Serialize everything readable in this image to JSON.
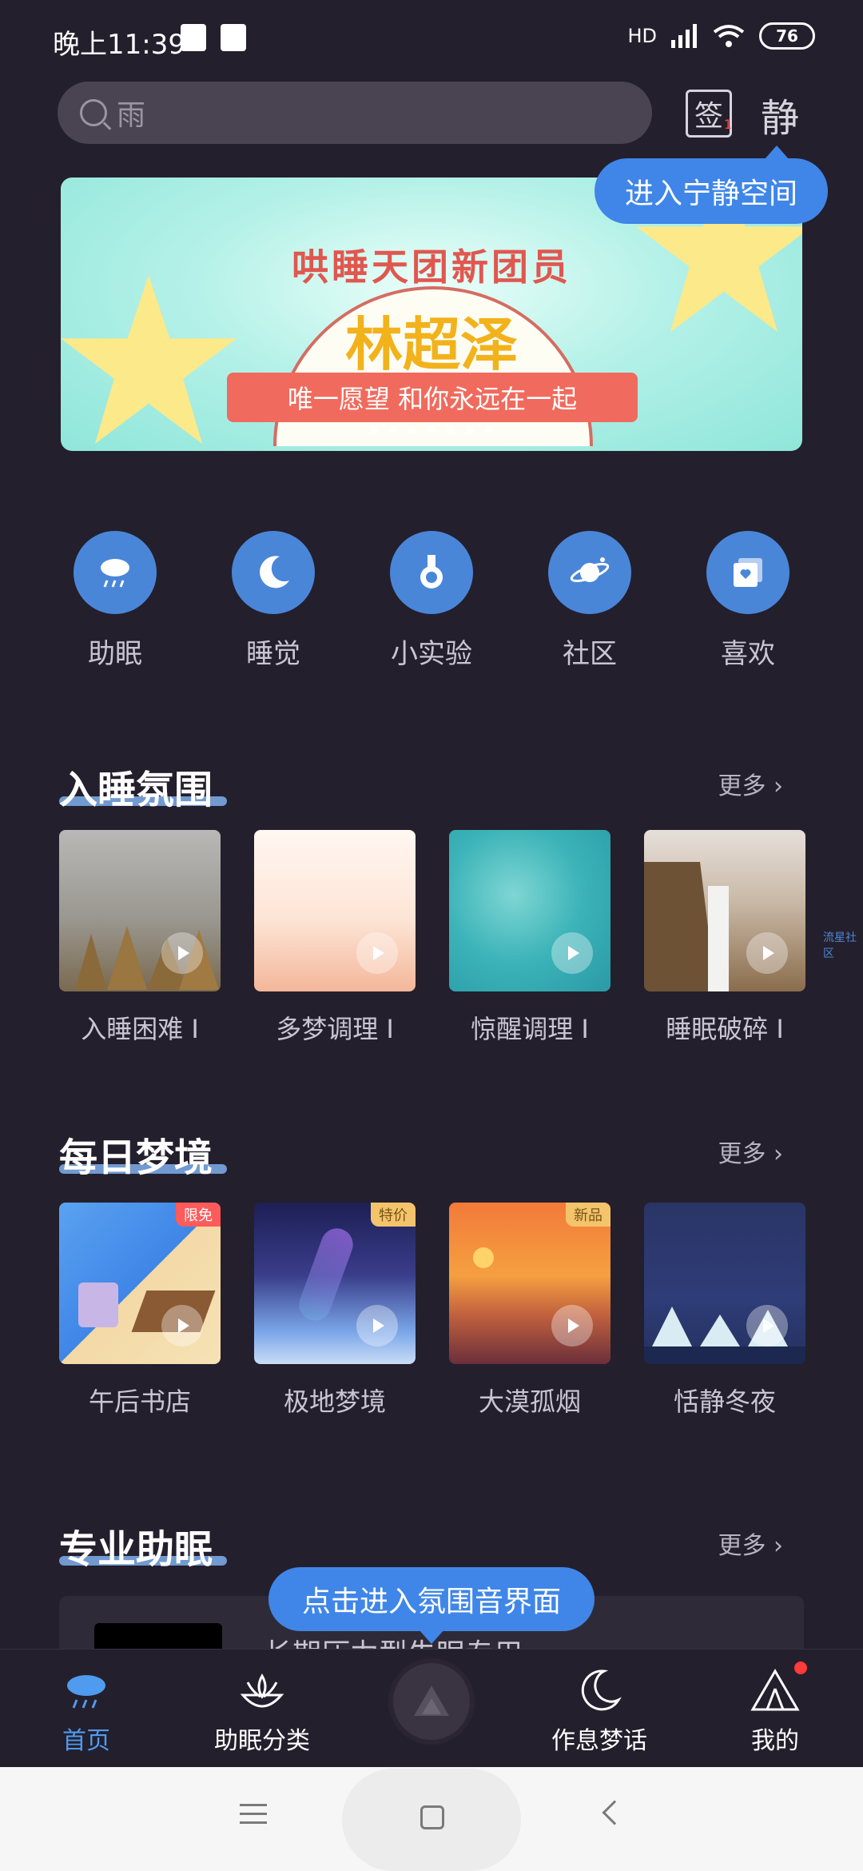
{
  "status_bar": {
    "time": "晚上11:39",
    "network": "HD",
    "battery": "76"
  },
  "search": {
    "placeholder": "雨"
  },
  "header": {
    "sign_label": "签",
    "jing_label": "静"
  },
  "tooltip_top": "进入宁静空间",
  "banner": {
    "headline": "哄睡天团新团员",
    "name": "林超泽",
    "tagline": "唯一愿望 和你永远在一起",
    "slides": 7
  },
  "quick_nav": [
    {
      "label": "助眠",
      "icon": "cloud-rain-icon"
    },
    {
      "label": "睡觉",
      "icon": "moon-icon"
    },
    {
      "label": "小实验",
      "icon": "flask-icon"
    },
    {
      "label": "社区",
      "icon": "planet-icon"
    },
    {
      "label": "喜欢",
      "icon": "heart-album-icon"
    }
  ],
  "section1": {
    "title": "入睡氛围",
    "more": "更多 ›",
    "items": [
      {
        "label": "入睡困难 I"
      },
      {
        "label": "多梦调理 I"
      },
      {
        "label": "惊醒调理 I"
      },
      {
        "label": "睡眠破碎 I"
      }
    ]
  },
  "side_label": "流星社区",
  "section2": {
    "title": "每日梦境",
    "more": "更多 ›",
    "items": [
      {
        "label": "午后书店",
        "badge": "限免"
      },
      {
        "label": "极地梦境",
        "badge": "特价"
      },
      {
        "label": "大漠孤烟",
        "badge": "新品"
      },
      {
        "label": "恬静冬夜",
        "badge": ""
      }
    ]
  },
  "section3": {
    "title": "专业助眠",
    "more": "更多 ›",
    "first_item": "长期压力型失眠专用"
  },
  "tooltip_bottom": "点击进入氛围音界面",
  "tabbar": [
    {
      "label": "首页",
      "active": true
    },
    {
      "label": "助眠分类",
      "active": false
    },
    {
      "label": "作息梦话",
      "active": false
    },
    {
      "label": "我的",
      "active": false
    }
  ],
  "colors": {
    "accent": "#3f86e8",
    "background": "#241f2c",
    "tab_active": "#4e9bf0"
  }
}
